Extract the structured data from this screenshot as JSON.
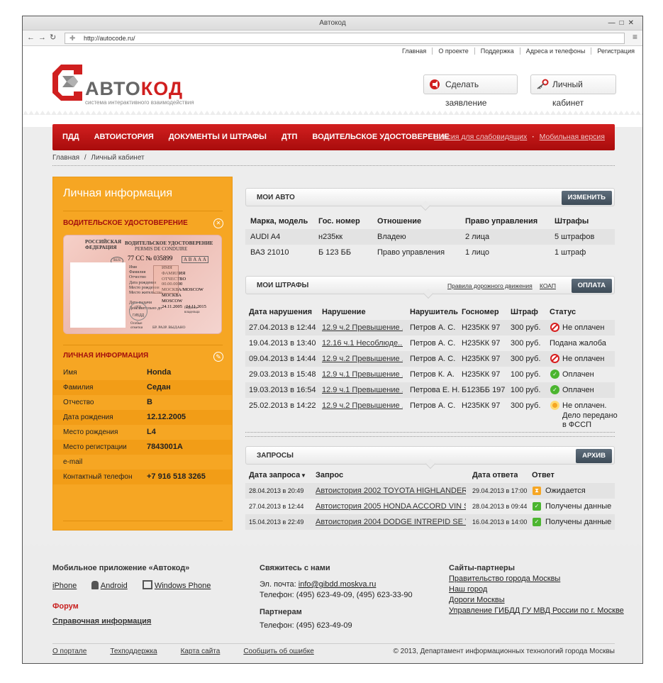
{
  "window": {
    "title": "Автокод",
    "url": "http://autocode.ru/"
  },
  "toplinks": [
    "Главная",
    "О проекте",
    "Поддержка",
    "Адреса и телефоны",
    "Регистрация"
  ],
  "logo": {
    "name_grey": "АВТО",
    "name_red": "КОД",
    "subtitle": "система интерактивного взаимодействия"
  },
  "header_buttons": {
    "statement": "Сделать заявление",
    "cabinet": "Личный кабинет"
  },
  "nav": {
    "items": [
      "ПДД",
      "АВТОИСТОРИЯ",
      "ДОКУМЕНТЫ И ШТРАФЫ",
      "ДТП",
      "ВОДИТЕЛЬСКОЕ УДОСТОВЕРЕНИЕ"
    ],
    "right": [
      "Версия для слабовидящих",
      "Мобильная версия"
    ],
    "separator": "·"
  },
  "breadcrumb": {
    "home": "Главная",
    "sep": "/",
    "current": "Личный кабинет"
  },
  "left": {
    "title": "Личная информация",
    "license_heading": "ВОДИТЕЛЬСКОЕ УДОСТОВЕРЕНИЕ",
    "license": {
      "country": "РОССИЙСКАЯ\nФЕДЕРАЦИЯ",
      "title_ru": "ВОДИТЕЛЬСКОЕ УДОСТОВЕРЕНИЕ",
      "title_fr": "PERMIS DE CONDUIRE",
      "number": "77 СС № 035899",
      "cats": "А В А А А",
      "region": "77",
      "code": "RUS",
      "fields_left": "Имя\nФамилия\nОтчество\nДата рождения\nМесто рождения\nМесто жительства\n\nДата выдачи\nДействительно до",
      "fields_right": "ИМЯ\nФАМИЛИЯ\nОТЧЕСТВО\n00.00.0000\nМОСКВА/MOSCOW\nМОСКВА\nMOSCOW\n24.11.2005   24.11.2015",
      "special": "Особые\nотметки",
      "signature": "Подпись\nвладельца",
      "issued_by": "БР. РАЗР. ВЫДАНО",
      "gibdd": "ГИБДД"
    },
    "personal_heading": "ЛИЧНАЯ ИНФОРМАЦИЯ",
    "rows": [
      {
        "k": "Имя",
        "v": "Honda"
      },
      {
        "k": "Фамилия",
        "v": "Седан"
      },
      {
        "k": "Отчество",
        "v": "B"
      },
      {
        "k": "Дата рождения",
        "v": "12.12.2005"
      },
      {
        "k": "Место рождения",
        "v": "L4"
      },
      {
        "k": "Место регистрации",
        "v": "7843001A"
      },
      {
        "k": "e-mail",
        "v": ""
      },
      {
        "k": "Контактный телефон",
        "v": "+7 916 518 3265"
      }
    ]
  },
  "cars": {
    "title": "МОИ АВТО",
    "button": "ИЗМЕНИТЬ",
    "headers": [
      "Марка, модель",
      "Гос. номер",
      "Отношение",
      "Право управления",
      "Штрафы"
    ],
    "rows": [
      [
        "AUDI A4",
        "н235кк",
        "Владею",
        "2 лица",
        "5 штрафов"
      ],
      [
        "ВАЗ 21010",
        "Б 123 ББ",
        "Право управления",
        "1 лицо",
        "1 штраф"
      ]
    ]
  },
  "fines": {
    "title": "МОИ ШТРАФЫ",
    "link1": "Правила дорожного движения",
    "link2": "КОАП",
    "button": "ОПЛАТА",
    "headers": [
      "Дата нарушения",
      "Нарушение",
      "Нарушитель",
      "Госномер",
      "Штраф",
      "Статус"
    ],
    "rows": [
      {
        "date": "27.04.2013 в 12:44",
        "violation": "12.9 ч.2 Превышение ...",
        "who": "Петров А. С.",
        "plate": "Н235КК 97",
        "amount": "300 руб.",
        "status": "Не оплачен",
        "icon": "no"
      },
      {
        "date": "19.04.2013 в 13:40",
        "violation": "12.16 ч.1 Несоблюде...",
        "who": "Петров А. С.",
        "plate": "Н235КК 97",
        "amount": "300 руб.",
        "status": "Подана жалоба",
        "icon": ""
      },
      {
        "date": "09.04.2013 в 14:44",
        "violation": "12.9 ч.2 Превышение ...",
        "who": "Петров А. С.",
        "plate": "Н235КК 97",
        "amount": "300 руб.",
        "status": "Не оплачен",
        "icon": "no"
      },
      {
        "date": "29.03.2013 в 15:48",
        "violation": "12.9 ч.1 Превышение ...",
        "who": "Петров К. А.",
        "plate": "Н235КК 97",
        "amount": "100 руб.",
        "status": "Оплачен",
        "icon": "ok"
      },
      {
        "date": "19.03.2013 в 16:54",
        "violation": "12.9 ч.1 Превышение ...",
        "who": "Петрова Е. Н.",
        "plate": "Б123ББ 197",
        "amount": "100 руб.",
        "status": "Оплачен",
        "icon": "ok"
      },
      {
        "date": "25.02.2013 в 14:22",
        "violation": "12.9 ч.2 Превышение ...",
        "who": "Петров А. С.",
        "plate": "Н235КК 97",
        "amount": "300 руб.",
        "status": "Не оплачен.",
        "status2": "Дело передано",
        "status3": "в ФССП",
        "icon": "wait"
      }
    ]
  },
  "requests": {
    "title": "ЗАПРОСЫ",
    "button": "АРХИВ",
    "headers": [
      "Дата запроса",
      "Запрос",
      "Дата ответа",
      "Ответ"
    ],
    "sort_icon": "▼",
    "rows": [
      {
        "date": "28.04.2013 в 20:49",
        "query": "Автоистория 2002 TOYOTA HIGHLANDER ...",
        "answer_date": "29.04.2013 в 17:00",
        "answer": "Ожидается",
        "icon": "wait"
      },
      {
        "date": "27.04.2013 в 12:44",
        "query": "Автоистория 2005 HONDA ACCORD VIN S...",
        "answer_date": "28.04.2013 в 09:44",
        "answer": "Получены данные",
        "icon": "ok"
      },
      {
        "date": "15.04.2013 в 22:49",
        "query": "Автоистория 2004 DODGE INTREPID SE V...",
        "answer_date": "16.04.2013 в 14:00",
        "answer": "Получены данные",
        "icon": "ok"
      }
    ]
  },
  "footer": {
    "apps_title": "Мобильное приложение «Автокод»",
    "apps": [
      "iPhone",
      "Android",
      "Windows Phone"
    ],
    "forum": "Форум",
    "help": "Справочная информация",
    "contact_title": "Свяжитесь с нами",
    "email_label": "Эл. почта: ",
    "email": "info@gibdd.moskva.ru",
    "phone": "Телефон: (495) 623-49-09, (495) 623-33-90",
    "partners_title": "Партнерам",
    "partners_phone": "Телефон: (495) 623-49-09",
    "sites_title": "Сайты-партнеры",
    "sites": [
      "Правительство города Москвы",
      "Наш город",
      "Дороги Москвы",
      "Управление ГИБДД ГУ МВД России по г. Москве"
    ],
    "bottom": [
      "О портале",
      "Техподдержка",
      "Карта сайта",
      "Сообщить об ошибке"
    ],
    "copyright": "© 2013, Департамент информационных технологий города Москвы"
  },
  "colors": {
    "red": "#d21f1f",
    "orange": "#f6a623",
    "dark_button": "#4a5866",
    "green": "#4bb52f"
  }
}
